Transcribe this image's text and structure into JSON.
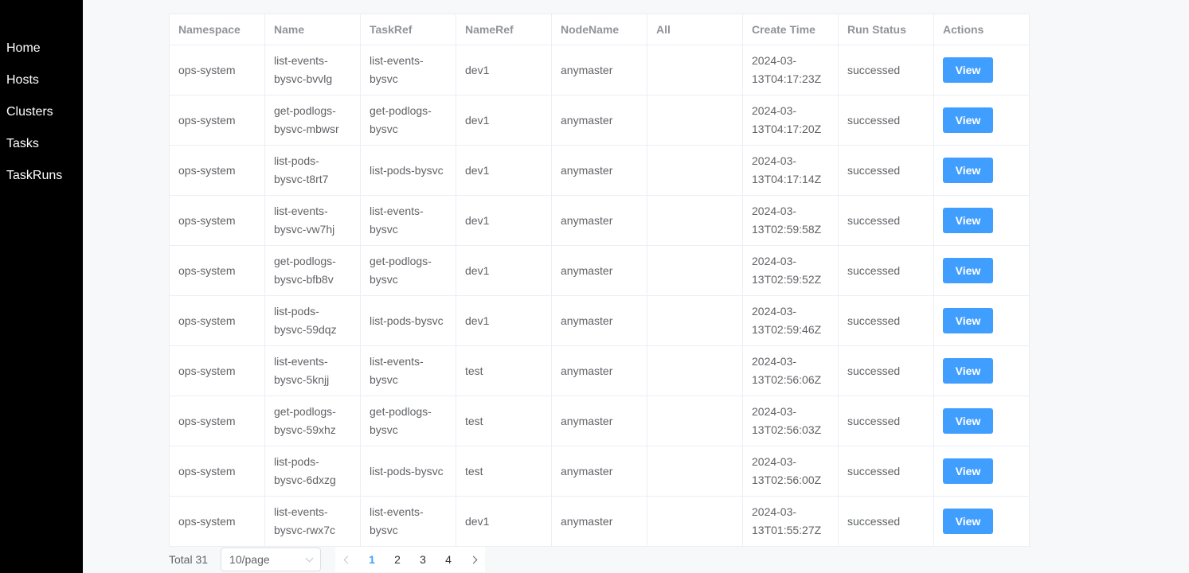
{
  "sidebar": {
    "items": [
      {
        "label": "Home"
      },
      {
        "label": "Hosts"
      },
      {
        "label": "Clusters"
      },
      {
        "label": "Tasks"
      },
      {
        "label": "TaskRuns"
      }
    ]
  },
  "table": {
    "headers": [
      "Namespace",
      "Name",
      "TaskRef",
      "NameRef",
      "NodeName",
      "All",
      "Create Time",
      "Run Status",
      "Actions"
    ],
    "view_label": "View",
    "rows": [
      {
        "namespace": "ops-system",
        "name": "list-events-bysvc-bvvlg",
        "taskref": "list-events-bysvc",
        "nameref": "dev1",
        "nodename": "anymaster",
        "all": "",
        "create_time": "2024-03-13T04:17:23Z",
        "status": "successed"
      },
      {
        "namespace": "ops-system",
        "name": "get-podlogs-bysvc-mbwsr",
        "taskref": "get-podlogs-bysvc",
        "nameref": "dev1",
        "nodename": "anymaster",
        "all": "",
        "create_time": "2024-03-13T04:17:20Z",
        "status": "successed"
      },
      {
        "namespace": "ops-system",
        "name": "list-pods-bysvc-t8rt7",
        "taskref": "list-pods-bysvc",
        "nameref": "dev1",
        "nodename": "anymaster",
        "all": "",
        "create_time": "2024-03-13T04:17:14Z",
        "status": "successed"
      },
      {
        "namespace": "ops-system",
        "name": "list-events-bysvc-vw7hj",
        "taskref": "list-events-bysvc",
        "nameref": "dev1",
        "nodename": "anymaster",
        "all": "",
        "create_time": "2024-03-13T02:59:58Z",
        "status": "successed"
      },
      {
        "namespace": "ops-system",
        "name": "get-podlogs-bysvc-bfb8v",
        "taskref": "get-podlogs-bysvc",
        "nameref": "dev1",
        "nodename": "anymaster",
        "all": "",
        "create_time": "2024-03-13T02:59:52Z",
        "status": "successed"
      },
      {
        "namespace": "ops-system",
        "name": "list-pods-bysvc-59dqz",
        "taskref": "list-pods-bysvc",
        "nameref": "dev1",
        "nodename": "anymaster",
        "all": "",
        "create_time": "2024-03-13T02:59:46Z",
        "status": "successed"
      },
      {
        "namespace": "ops-system",
        "name": "list-events-bysvc-5knjj",
        "taskref": "list-events-bysvc",
        "nameref": "test",
        "nodename": "anymaster",
        "all": "",
        "create_time": "2024-03-13T02:56:06Z",
        "status": "successed"
      },
      {
        "namespace": "ops-system",
        "name": "get-podlogs-bysvc-59xhz",
        "taskref": "get-podlogs-bysvc",
        "nameref": "test",
        "nodename": "anymaster",
        "all": "",
        "create_time": "2024-03-13T02:56:03Z",
        "status": "successed"
      },
      {
        "namespace": "ops-system",
        "name": "list-pods-bysvc-6dxzg",
        "taskref": "list-pods-bysvc",
        "nameref": "test",
        "nodename": "anymaster",
        "all": "",
        "create_time": "2024-03-13T02:56:00Z",
        "status": "successed"
      },
      {
        "namespace": "ops-system",
        "name": "list-events-bysvc-rwx7c",
        "taskref": "list-events-bysvc",
        "nameref": "dev1",
        "nodename": "anymaster",
        "all": "",
        "create_time": "2024-03-13T01:55:27Z",
        "status": "successed"
      }
    ]
  },
  "pagination": {
    "total_label": "Total 31",
    "page_size": "10/page",
    "pages": [
      "1",
      "2",
      "3",
      "4"
    ],
    "current_page": "1"
  },
  "colors": {
    "accent": "#409eff",
    "sidebar_bg": "#000000"
  }
}
